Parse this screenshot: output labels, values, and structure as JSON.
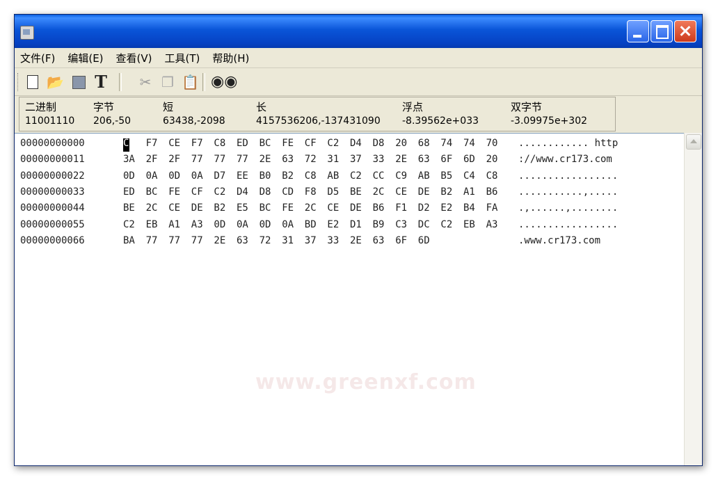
{
  "window": {
    "title": "",
    "accent": "#0a55d8"
  },
  "titlebar_buttons": {
    "minimize_icon": "minimize-icon",
    "maximize_icon": "maximize-icon",
    "close_icon": "close-icon"
  },
  "menu": [
    "文件(F)",
    "编辑(E)",
    "查看(V)",
    "工具(T)",
    "帮助(H)"
  ],
  "toolbar": {
    "new_icon": "new-file-icon",
    "open_icon": "open-folder-icon",
    "save_icon": "save-icon",
    "text_label": "T",
    "cut_icon": "cut-icon",
    "copy_icon": "copy-icon",
    "paste_icon": "paste-icon",
    "find_icon": "binoculars-icon"
  },
  "info": {
    "binary": {
      "label": "二进制",
      "value": "11001110"
    },
    "byte": {
      "label": "字节",
      "value": "206,-50"
    },
    "short": {
      "label": "短",
      "value": "63438,-2098"
    },
    "long": {
      "label": "长",
      "value": "4157536206,-137431090"
    },
    "float": {
      "label": "浮点",
      "value": "-8.39562e+033"
    },
    "double": {
      "label": "双字节",
      "value": "-3.09975e+302"
    }
  },
  "rows": [
    {
      "addr": "00000000000",
      "bytes": [
        "CE",
        "F7",
        "CE",
        "F7",
        "C8",
        "ED",
        "BC",
        "FE",
        "CF",
        "C2",
        "D4",
        "D8",
        "20",
        "68",
        "74",
        "74",
        "70"
      ],
      "ascii": "............ http"
    },
    {
      "addr": "00000000011",
      "bytes": [
        "3A",
        "2F",
        "2F",
        "77",
        "77",
        "77",
        "2E",
        "63",
        "72",
        "31",
        "37",
        "33",
        "2E",
        "63",
        "6F",
        "6D",
        "20"
      ],
      "ascii": "://www.cr173.com"
    },
    {
      "addr": "00000000022",
      "bytes": [
        "0D",
        "0A",
        "0D",
        "0A",
        "D7",
        "EE",
        "B0",
        "B2",
        "C8",
        "AB",
        "C2",
        "CC",
        "C9",
        "AB",
        "B5",
        "C4",
        "C8"
      ],
      "ascii": "................."
    },
    {
      "addr": "00000000033",
      "bytes": [
        "ED",
        "BC",
        "FE",
        "CF",
        "C2",
        "D4",
        "D8",
        "CD",
        "F8",
        "D5",
        "BE",
        "2C",
        "CE",
        "DE",
        "B2",
        "A1",
        "B6"
      ],
      "ascii": "...........,....."
    },
    {
      "addr": "00000000044",
      "bytes": [
        "BE",
        "2C",
        "CE",
        "DE",
        "B2",
        "E5",
        "BC",
        "FE",
        "2C",
        "CE",
        "DE",
        "B6",
        "F1",
        "D2",
        "E2",
        "B4",
        "FA"
      ],
      "ascii": ".,......,........"
    },
    {
      "addr": "00000000055",
      "bytes": [
        "C2",
        "EB",
        "A1",
        "A3",
        "0D",
        "0A",
        "0D",
        "0A",
        "BD",
        "E2",
        "D1",
        "B9",
        "C3",
        "DC",
        "C2",
        "EB",
        "A3"
      ],
      "ascii": "................."
    },
    {
      "addr": "00000000066",
      "bytes": [
        "BA",
        "77",
        "77",
        "77",
        "2E",
        "63",
        "72",
        "31",
        "37",
        "33",
        "2E",
        "63",
        "6F",
        "6D"
      ],
      "ascii": ".www.cr173.com"
    }
  ],
  "watermark": "www.greenxf.com"
}
